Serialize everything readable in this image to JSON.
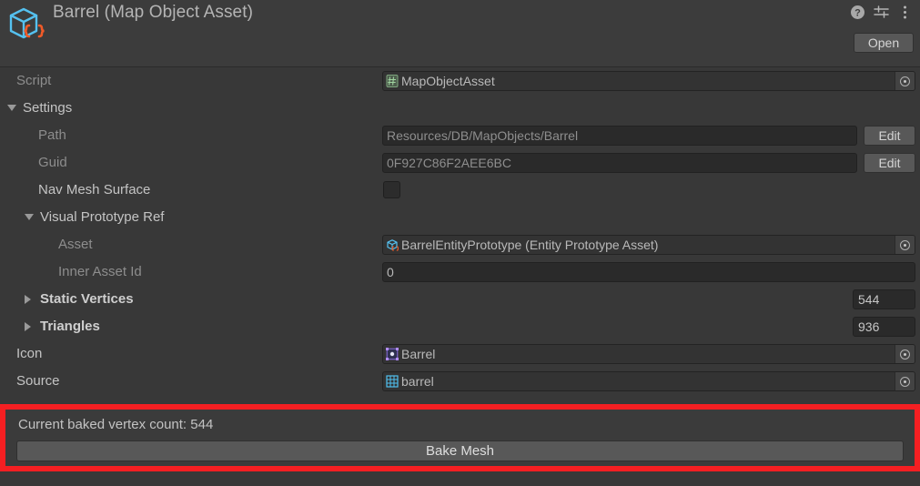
{
  "window": {
    "title": "Barrel (Map Object Asset)",
    "asset_icon": "map-object-asset-cube-braces-icon",
    "help_icon": "help-icon",
    "preset_icon": "preset-settings-icon",
    "menu_icon": "more-menu-icon",
    "open_label": "Open",
    "accent_highlight_color": "#f51f22",
    "background_color": "#383838"
  },
  "rows": {
    "script": {
      "label": "Script",
      "value": "MapObjectAsset",
      "icon": "cs-script-icon"
    },
    "settings": {
      "label": "Settings",
      "expanded": true
    },
    "path": {
      "label": "Path",
      "value": "Resources/DB/MapObjects/Barrel",
      "edit_label": "Edit"
    },
    "guid": {
      "label": "Guid",
      "value": "0F927C86F2AEE6BC",
      "edit_label": "Edit"
    },
    "nav_mesh_surface": {
      "label": "Nav Mesh Surface",
      "checked": false
    },
    "visual_prototype_ref": {
      "label": "Visual Prototype Ref",
      "expanded": true
    },
    "asset": {
      "label": "Asset",
      "value": "BarrelEntityPrototype (Entity Prototype Asset)",
      "icon": "entity-prototype-cube-icon"
    },
    "inner_asset_id": {
      "label": "Inner Asset Id",
      "value": "0"
    },
    "static_vertices": {
      "label": "Static Vertices",
      "size": "544",
      "expanded": false
    },
    "triangles": {
      "label": "Triangles",
      "size": "936",
      "expanded": false
    },
    "icon": {
      "label": "Icon",
      "value": "Barrel",
      "icon": "sprite-icon"
    },
    "source": {
      "label": "Source",
      "value": "barrel",
      "icon": "mesh-grid-icon"
    }
  },
  "footer": {
    "vertex_count_text": "Current baked vertex count: 544",
    "bake_button_label": "Bake Mesh"
  }
}
